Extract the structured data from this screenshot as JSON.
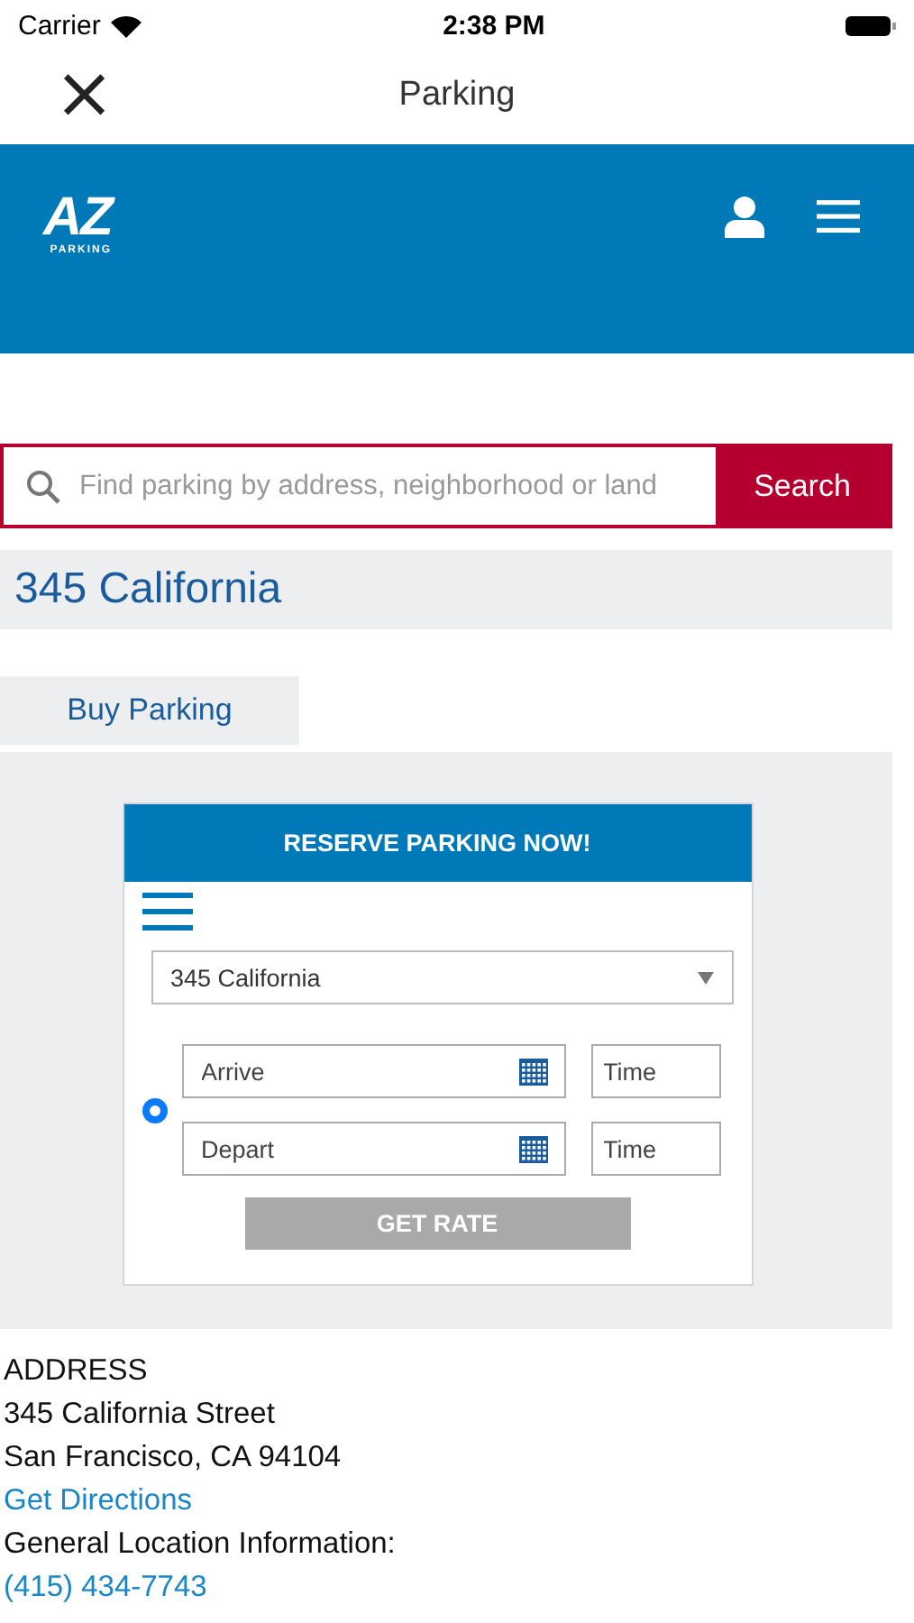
{
  "status_bar": {
    "carrier": "Carrier",
    "time": "2:38 PM"
  },
  "nav": {
    "close": "×",
    "title": "Parking"
  },
  "header": {
    "logo": "AZ",
    "logo_sub": "PARKING"
  },
  "search": {
    "placeholder": "Find parking by address, neighborhood or land",
    "button": "Search"
  },
  "location": {
    "title": "345 California"
  },
  "tabs": [
    {
      "label": "Buy Parking",
      "selected": true
    }
  ],
  "reserve": {
    "title": "RESERVE PARKING NOW!",
    "location": "345 California",
    "rows": [
      {
        "date_placeholder": "Arrive",
        "time_placeholder": "Time"
      },
      {
        "date_placeholder": "Depart",
        "time_placeholder": "Time"
      }
    ],
    "option": {
      "selected": true
    },
    "button": {
      "label": "GET RATE",
      "disabled": true
    }
  },
  "address": {
    "heading": "ADDRESS",
    "lines": [
      "345 California Street",
      "San Francisco, CA 94104"
    ],
    "directions": "Get Directions",
    "info_label": "General Location Information:",
    "phone": "(415) 434-7743"
  }
}
